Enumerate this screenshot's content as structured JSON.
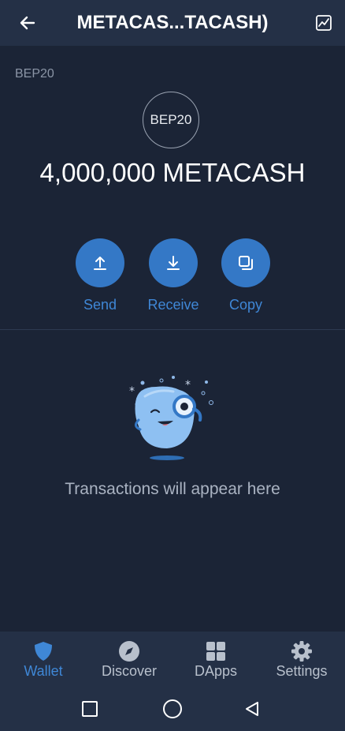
{
  "header": {
    "title": "METACAS...TACASH)",
    "back_icon": "arrow-left-icon",
    "chart_icon": "chart-icon"
  },
  "token": {
    "network": "BEP20",
    "logo_text": "BEP20",
    "balance": "4,000,000 METACASH"
  },
  "actions": {
    "send_label": "Send",
    "receive_label": "Receive",
    "copy_label": "Copy"
  },
  "empty_state": {
    "message": "Transactions will appear here"
  },
  "bottom_nav": {
    "items": [
      {
        "label": "Wallet",
        "icon": "shield-icon",
        "active": true
      },
      {
        "label": "Discover",
        "icon": "compass-icon",
        "active": false
      },
      {
        "label": "DApps",
        "icon": "grid-icon",
        "active": false
      },
      {
        "label": "Settings",
        "icon": "gear-icon",
        "active": false
      }
    ]
  },
  "colors": {
    "background": "#1b2436",
    "header": "#243046",
    "accent": "#3478c6",
    "accent_text": "#3f87d6"
  }
}
